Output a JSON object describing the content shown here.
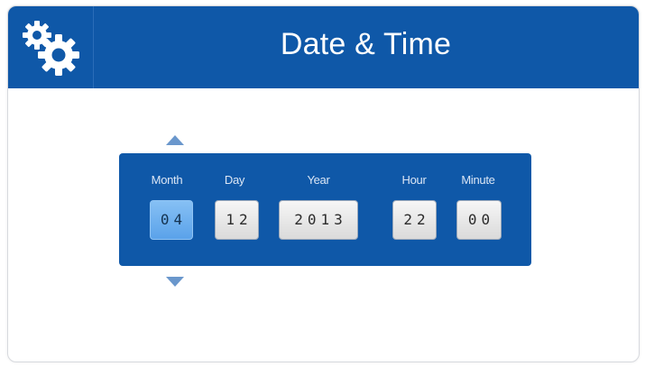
{
  "header": {
    "title": "Date & Time",
    "settings_icon": "gears-icon"
  },
  "picker": {
    "up_icon": "arrow-up-icon",
    "down_icon": "arrow-down-icon",
    "fields": [
      {
        "label": "Month",
        "value": "04",
        "active": true
      },
      {
        "label": "Day",
        "value": "12",
        "active": false
      },
      {
        "label": "Year",
        "value": "2013",
        "active": false
      },
      {
        "label": "Hour",
        "value": "22",
        "active": false
      },
      {
        "label": "Minute",
        "value": "00",
        "active": false
      }
    ]
  },
  "colors": {
    "header_blue": "#0f58a8",
    "active_field": "#6aaeef",
    "arrow": "#6a97cc"
  }
}
